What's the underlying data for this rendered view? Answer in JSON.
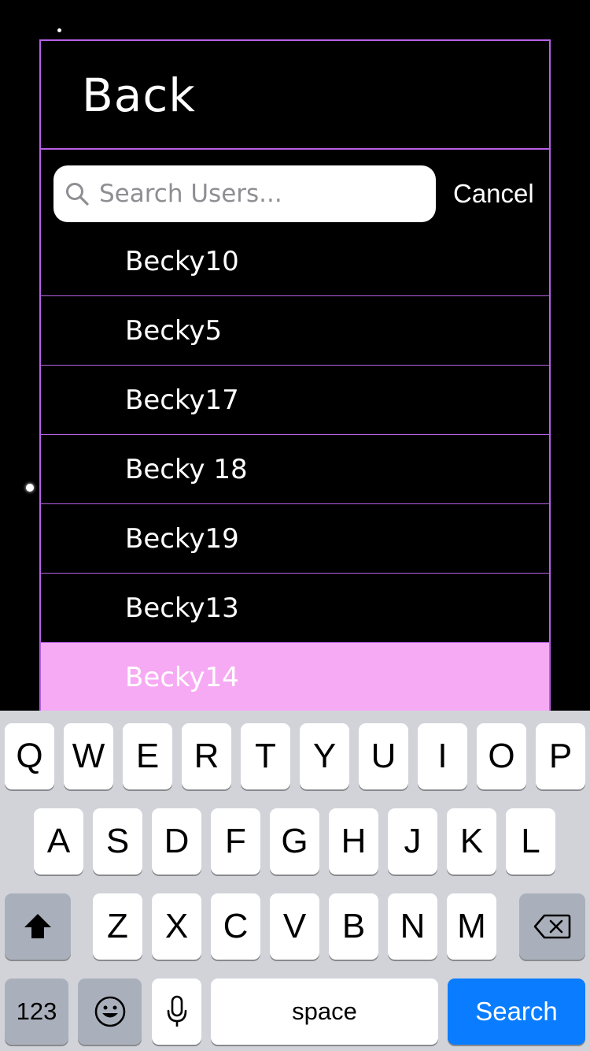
{
  "colors": {
    "accent_border": "#b760e6",
    "selected_row": "#f7aaf4",
    "keyboard_bg": "#d1d3d9",
    "search_key": "#0a7cff"
  },
  "header": {
    "back_label": "Back"
  },
  "search": {
    "placeholder": "Search Users...",
    "value": "",
    "cancel_label": "Cancel",
    "icon": "search-icon"
  },
  "users": [
    {
      "name": "Becky10",
      "selected": false
    },
    {
      "name": "Becky5",
      "selected": false
    },
    {
      "name": "Becky17",
      "selected": false
    },
    {
      "name": "Becky 18",
      "selected": false
    },
    {
      "name": "Becky19",
      "selected": false
    },
    {
      "name": "Becky13",
      "selected": false
    },
    {
      "name": "Becky14",
      "selected": true
    }
  ],
  "keyboard": {
    "row1": [
      "Q",
      "W",
      "E",
      "R",
      "T",
      "Y",
      "U",
      "I",
      "O",
      "P"
    ],
    "row2": [
      "A",
      "S",
      "D",
      "F",
      "G",
      "H",
      "J",
      "K",
      "L"
    ],
    "row3": [
      "Z",
      "X",
      "C",
      "V",
      "B",
      "N",
      "M"
    ],
    "numbers_label": "123",
    "space_label": "space",
    "search_label": "Search",
    "shift_icon": "shift-icon",
    "delete_icon": "delete-icon",
    "emoji_icon": "emoji-icon",
    "mic_icon": "microphone-icon"
  }
}
